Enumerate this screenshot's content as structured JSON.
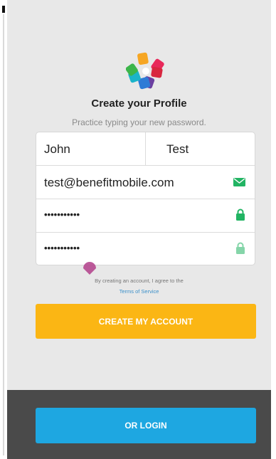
{
  "header": {
    "title": "Create your Profile",
    "subtitle": "Practice typing your new password."
  },
  "form": {
    "first_name": "John",
    "last_name": "Test",
    "email": "test@benefitmobile.com",
    "password": "•••••••••••",
    "confirm_password": "•••••••••••",
    "email_icon": "mail-icon",
    "password_icon": "lock-icon",
    "confirm_icon": "lock-icon"
  },
  "agreement": {
    "text": "By creating an account, I agree to the",
    "link": "Terms of Service"
  },
  "buttons": {
    "create_label": "CREATE MY ACCOUNT",
    "login_label": "OR LOGIN"
  },
  "colors": {
    "accent_yellow": "#fbb614",
    "accent_blue": "#1ea7e1",
    "valid_green": "#22b463",
    "link_blue": "#3a8fc9",
    "handle_purple": "#b5488f"
  }
}
